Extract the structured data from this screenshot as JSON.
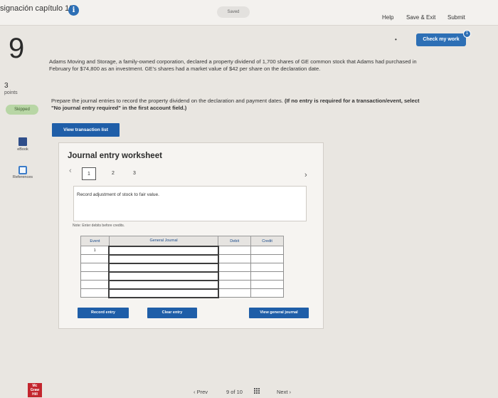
{
  "header": {
    "assignment_title": "signación capítulo 18",
    "saved_label": "Saved",
    "help": "Help",
    "save_exit": "Save & Exit",
    "submit": "Submit"
  },
  "question": {
    "number": "9",
    "points_value": "3",
    "points_label": "points",
    "status": "Skipped",
    "ebook_label": "eBook",
    "references_label": "References",
    "check_label": "Check my work",
    "check_badge": "1",
    "problem_text": "Adams Moving and Storage, a family-owned corporation, declared a property dividend of 1,700 shares of GE common stock that Adams had purchased in February for $74,800 as an investment. GE's shares had a market value of $42 per share on the declaration date.",
    "instruction_plain": "Prepare the journal entries to record the property dividend on the declaration and payment dates.",
    "instruction_bold": "(If no entry is required for a transaction/event, select \"No journal entry required\" in the first account field.)",
    "view_transaction_list": "View transaction list"
  },
  "worksheet": {
    "title": "Journal entry worksheet",
    "tabs": [
      "1",
      "2",
      "3"
    ],
    "active_tab": "1",
    "description": "Record adjustment of stock to fair value.",
    "note": "Note: Enter debits before credits.",
    "columns": [
      "Event",
      "General Journal",
      "Debit",
      "Credit"
    ],
    "rows": [
      {
        "event": "1",
        "account": "",
        "debit": "",
        "credit": ""
      },
      {
        "event": "",
        "account": "",
        "debit": "",
        "credit": ""
      },
      {
        "event": "",
        "account": "",
        "debit": "",
        "credit": ""
      },
      {
        "event": "",
        "account": "",
        "debit": "",
        "credit": ""
      },
      {
        "event": "",
        "account": "",
        "debit": "",
        "credit": ""
      },
      {
        "event": "",
        "account": "",
        "debit": "",
        "credit": ""
      }
    ],
    "record_entry": "Record entry",
    "clear_entry": "Clear entry",
    "view_general_journal": "View general journal"
  },
  "footer": {
    "logo_text": "Mc Graw Hill",
    "prev": "Prev",
    "page_current": "9",
    "page_of": "of",
    "page_total": "10",
    "next": "Next"
  }
}
